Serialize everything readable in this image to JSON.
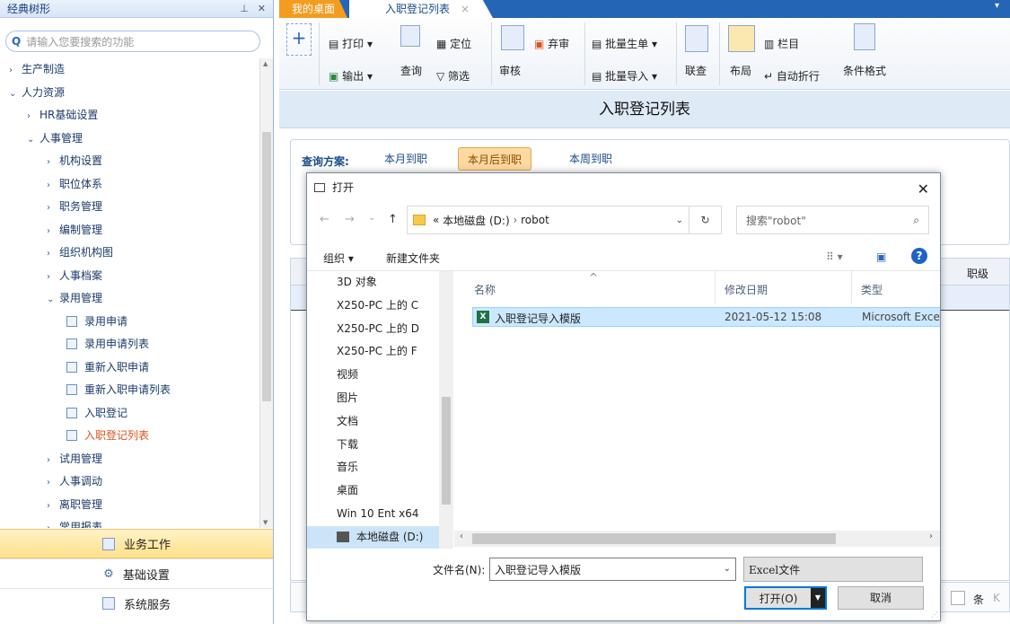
{
  "sidebar": {
    "title": "经典树形",
    "pin_icon": "pin-icon",
    "close_icon": "close-icon",
    "search_placeholder": "请输入您要搜索的功能",
    "tree": [
      {
        "label": "生产制造",
        "arrow": "›",
        "depth": 0
      },
      {
        "label": "人力资源",
        "arrow": "⌄",
        "depth": 0
      },
      {
        "label": "HR基础设置",
        "arrow": "›",
        "depth": 1
      },
      {
        "label": "人事管理",
        "arrow": "⌄",
        "depth": 1
      },
      {
        "label": "机构设置",
        "arrow": "›",
        "depth": 2
      },
      {
        "label": "职位体系",
        "arrow": "›",
        "depth": 2
      },
      {
        "label": "职务管理",
        "arrow": "›",
        "depth": 2
      },
      {
        "label": "编制管理",
        "arrow": "›",
        "depth": 2
      },
      {
        "label": "组织机构图",
        "arrow": "›",
        "depth": 2
      },
      {
        "label": "人事档案",
        "arrow": "›",
        "depth": 2
      },
      {
        "label": "录用管理",
        "arrow": "⌄",
        "depth": 2
      },
      {
        "label": "录用申请",
        "arrow": "",
        "depth": 3
      },
      {
        "label": "录用申请列表",
        "arrow": "",
        "depth": 3
      },
      {
        "label": "重新入职申请",
        "arrow": "",
        "depth": 3
      },
      {
        "label": "重新入职申请列表",
        "arrow": "",
        "depth": 3
      },
      {
        "label": "入职登记",
        "arrow": "",
        "depth": 3
      },
      {
        "label": "入职登记列表",
        "arrow": "",
        "depth": 3,
        "active": true
      },
      {
        "label": "试用管理",
        "arrow": "›",
        "depth": 2
      },
      {
        "label": "人事调动",
        "arrow": "›",
        "depth": 2
      },
      {
        "label": "离职管理",
        "arrow": "›",
        "depth": 2
      },
      {
        "label": "常用报表",
        "arrow": "›",
        "depth": 2
      }
    ],
    "panels": {
      "business": "业务工作",
      "basic": "基础设置",
      "system": "系统服务"
    }
  },
  "tabs": {
    "home": "我的桌面",
    "current": "入职登记列表",
    "close": "×",
    "menu": "▾"
  },
  "ribbon": {
    "print": "打印",
    "export": "输出",
    "locate": "定位",
    "query": "查询",
    "filter": "筛选",
    "audit": "审核",
    "reject": "弃审",
    "batch_gen": "批量生单",
    "batch_import": "批量导入",
    "link_query": "联查",
    "layout": "布局",
    "column": "栏目",
    "autowrap": "自动折行",
    "cond_format": "条件格式",
    "plus": "+"
  },
  "page_title": "入职登记列表",
  "query": {
    "label": "查询方案:",
    "options": [
      "本月到职",
      "本月后到职",
      "本周到职"
    ],
    "selected": 1
  },
  "grid": {
    "col_rank": "职级"
  },
  "pager": {
    "unit": "条",
    "nav": "K"
  },
  "dialog": {
    "title": "打开",
    "close": "✕",
    "nav": {
      "back": "←",
      "forward": "→",
      "recent": "⌄",
      "up": "↑"
    },
    "address": {
      "prefix": "«",
      "drive": "本地磁盘 (D:)",
      "sep": "›",
      "folder": "robot"
    },
    "search_placeholder": "搜索\"robot\"",
    "organize": "组织 ▾",
    "new_folder": "新建文件夹",
    "help": "?",
    "nav_items": [
      {
        "label": "3D 对象",
        "icon": "cube"
      },
      {
        "label": "X250-PC 上的 C",
        "icon": "drive"
      },
      {
        "label": "X250-PC 上的 D",
        "icon": "drive"
      },
      {
        "label": "X250-PC 上的 F",
        "icon": "drive"
      },
      {
        "label": "视频",
        "icon": "video"
      },
      {
        "label": "图片",
        "icon": "picture"
      },
      {
        "label": "文档",
        "icon": "doc"
      },
      {
        "label": "下载",
        "icon": "download"
      },
      {
        "label": "音乐",
        "icon": "music"
      },
      {
        "label": "桌面",
        "icon": "desktop"
      },
      {
        "label": "Win 10 Ent x64",
        "icon": "os"
      },
      {
        "label": "本地磁盘 (D:)",
        "icon": "disk",
        "selected": true
      }
    ],
    "columns": {
      "name": "名称",
      "modified": "修改日期",
      "type": "类型"
    },
    "files": [
      {
        "name": "入职登记导入模版",
        "modified": "2021-05-12 15:08",
        "type": "Microsoft Exce"
      }
    ],
    "filename_label": "文件名(N):",
    "filename_value": "入职登记导入模版",
    "filetype": "Excel文件",
    "open_label": "打开(O)",
    "cancel_label": "取消"
  },
  "colors": {
    "accent": "#2466b5",
    "tab_home": "#f39c1f",
    "active_item": "#d9531e",
    "selection": "#cce8ff"
  }
}
